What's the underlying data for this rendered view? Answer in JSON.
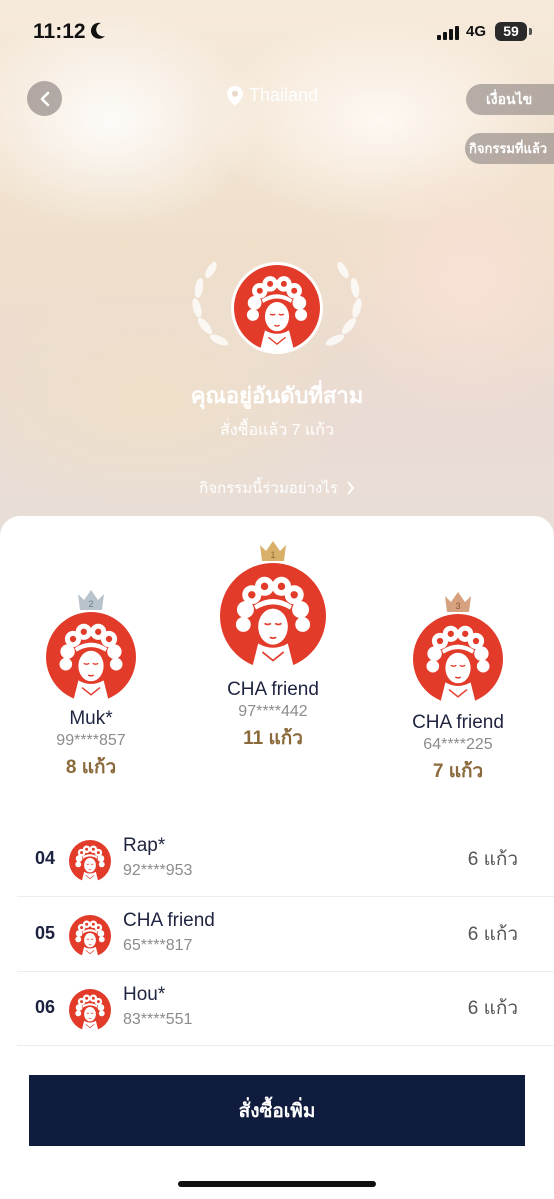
{
  "status": {
    "time": "11:12",
    "network": "4G",
    "battery": "59"
  },
  "header": {
    "location": "Thailand",
    "conditions_label": "เงื่อนไข",
    "past_events_label": "กิจกรรมที่แล้ว"
  },
  "hero": {
    "rank_text": "คุณอยู่อันดับที่สาม",
    "ordered_text": "สั่งซื้อแล้ว 7 แก้ว",
    "how_to_join": "กิจกรรมนี้ร่วมอย่างไร"
  },
  "podium": [
    {
      "rank": "2",
      "name": "Muk*",
      "phone": "99****857",
      "cups": "8 แก้ว",
      "crown_color": "#b9c3cc"
    },
    {
      "rank": "1",
      "name": "CHA friend",
      "phone": "97****442",
      "cups": "11 แก้ว",
      "crown_color": "#d9b06a"
    },
    {
      "rank": "3",
      "name": "CHA friend",
      "phone": "64****225",
      "cups": "7 แก้ว",
      "crown_color": "#d5a17e"
    }
  ],
  "list": [
    {
      "rank": "04",
      "name": "Rap*",
      "phone": "92****953",
      "cups": "6 แก้ว"
    },
    {
      "rank": "05",
      "name": "CHA friend",
      "phone": "65****817",
      "cups": "6 แก้ว"
    },
    {
      "rank": "06",
      "name": "Hou*",
      "phone": "83****551",
      "cups": "6 แก้ว"
    }
  ],
  "cta": {
    "label": "สั่งซื้อเพิ่ม"
  },
  "colors": {
    "brand_red": "#e23b2a",
    "navy": "#0f1c3d",
    "gold_text": "#8a6a3a"
  }
}
